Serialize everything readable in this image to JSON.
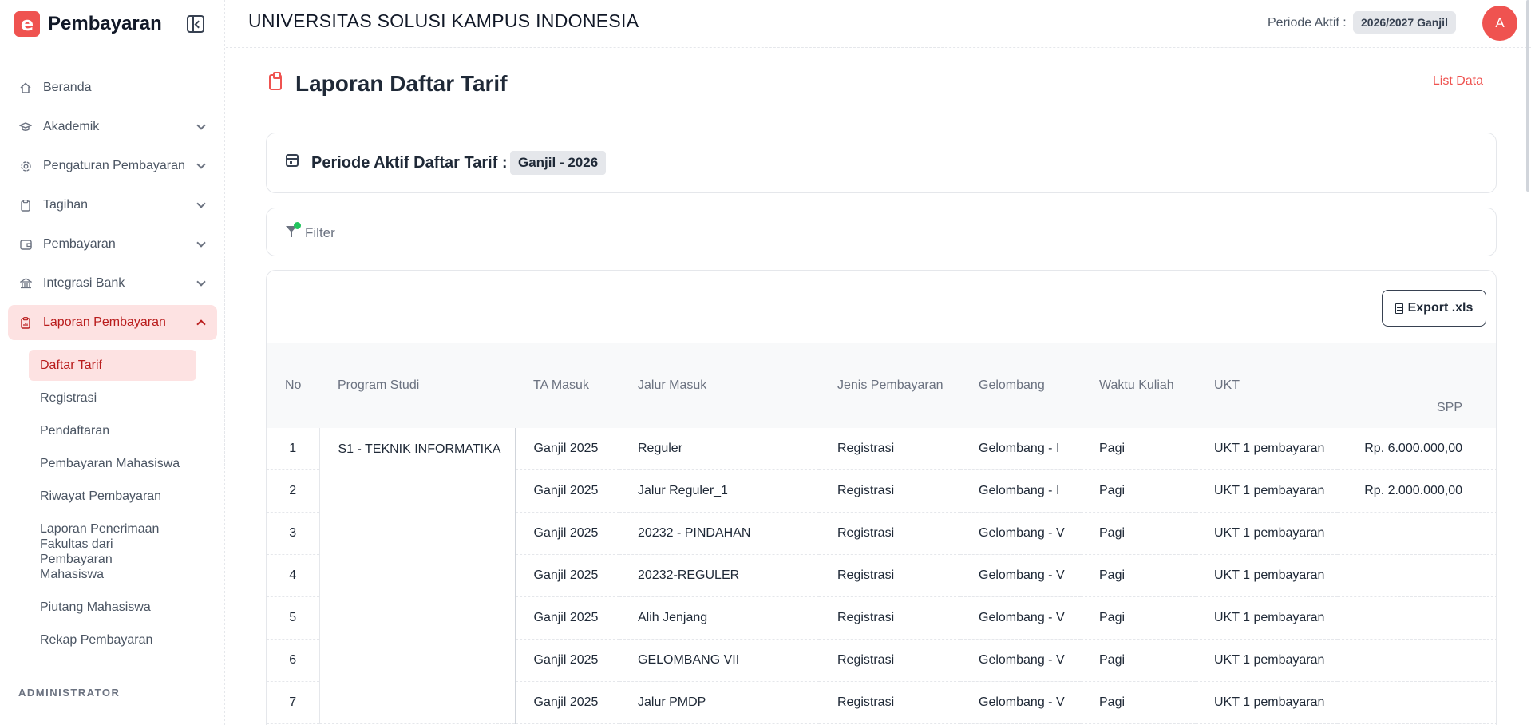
{
  "app": {
    "name": "Pembayaran",
    "logo_letter": "e"
  },
  "sidebar": {
    "items": [
      {
        "label": "Beranda",
        "icon": "home-icon",
        "has_chevron": false
      },
      {
        "label": "Akademik",
        "icon": "graduation-cap-icon",
        "has_chevron": true
      },
      {
        "label": "Pengaturan Pembayaran",
        "icon": "settings-icon",
        "has_chevron": true
      },
      {
        "label": "Tagihan",
        "icon": "clipboard-icon",
        "has_chevron": true
      },
      {
        "label": "Pembayaran",
        "icon": "wallet-icon",
        "has_chevron": true
      },
      {
        "label": "Integrasi Bank",
        "icon": "bank-icon",
        "has_chevron": true
      },
      {
        "label": "Laporan Pembayaran",
        "icon": "report-icon",
        "has_chevron": true,
        "active": true
      }
    ],
    "subitems": [
      {
        "label": "Daftar Tarif",
        "active": true
      },
      {
        "label": "Registrasi"
      },
      {
        "label": "Pendaftaran"
      },
      {
        "label": "Pembayaran Mahasiswa"
      },
      {
        "label": "Riwayat Pembayaran"
      },
      {
        "label": "Laporan Penerimaan Fakultas dari Pembayaran Mahasiswa"
      },
      {
        "label": "Piutang Mahasiswa"
      },
      {
        "label": "Rekap Pembayaran"
      }
    ],
    "section_label": "ADMINISTRATOR"
  },
  "header": {
    "university": "UNIVERSITAS SOLUSI KAMPUS INDONESIA",
    "periode_label": "Periode Aktif :",
    "periode_value": "2026/2027 Ganjil",
    "avatar_letter": "A"
  },
  "page": {
    "title": "Laporan Daftar Tarif",
    "list_data_label": "List Data",
    "periode_card_label": "Periode Aktif Daftar Tarif :",
    "periode_card_value": "Ganjil - 2026",
    "filter_label": "Filter",
    "export_label": "Export .xls"
  },
  "table": {
    "headers": [
      "No",
      "Program Studi",
      "TA Masuk",
      "Jalur Masuk",
      "Jenis Pembayaran",
      "Gelombang",
      "Waktu Kuliah",
      "UKT",
      "SPP"
    ],
    "program_studi": "S1 - TEKNIK INFORMATIKA",
    "rows": [
      {
        "no": "1",
        "ta_masuk": "Ganjil 2025",
        "jalur": "Reguler",
        "jenis": "Registrasi",
        "gelombang": "Gelombang - I",
        "waktu": "Pagi",
        "ukt": "UKT 1 pembayaran",
        "spp": "Rp. 6.000.000,00"
      },
      {
        "no": "2",
        "ta_masuk": "Ganjil 2025",
        "jalur": "Jalur Reguler_1",
        "jenis": "Registrasi",
        "gelombang": "Gelombang - I",
        "waktu": "Pagi",
        "ukt": "UKT 1 pembayaran",
        "spp": "Rp. 2.000.000,00"
      },
      {
        "no": "3",
        "ta_masuk": "Ganjil 2025",
        "jalur": "20232 - PINDAHAN",
        "jenis": "Registrasi",
        "gelombang": "Gelombang - V",
        "waktu": "Pagi",
        "ukt": "UKT 1 pembayaran",
        "spp": ""
      },
      {
        "no": "4",
        "ta_masuk": "Ganjil 2025",
        "jalur": "20232-REGULER",
        "jenis": "Registrasi",
        "gelombang": "Gelombang - V",
        "waktu": "Pagi",
        "ukt": "UKT 1 pembayaran",
        "spp": ""
      },
      {
        "no": "5",
        "ta_masuk": "Ganjil 2025",
        "jalur": "Alih Jenjang",
        "jenis": "Registrasi",
        "gelombang": "Gelombang - V",
        "waktu": "Pagi",
        "ukt": "UKT 1 pembayaran",
        "spp": ""
      },
      {
        "no": "6",
        "ta_masuk": "Ganjil 2025",
        "jalur": "GELOMBANG VII",
        "jenis": "Registrasi",
        "gelombang": "Gelombang - V",
        "waktu": "Pagi",
        "ukt": "UKT 1 pembayaran",
        "spp": ""
      },
      {
        "no": "7",
        "ta_masuk": "Ganjil 2025",
        "jalur": "Jalur PMDP",
        "jenis": "Registrasi",
        "gelombang": "Gelombang - V",
        "waktu": "Pagi",
        "ukt": "UKT 1 pembayaran",
        "spp": ""
      }
    ]
  }
}
